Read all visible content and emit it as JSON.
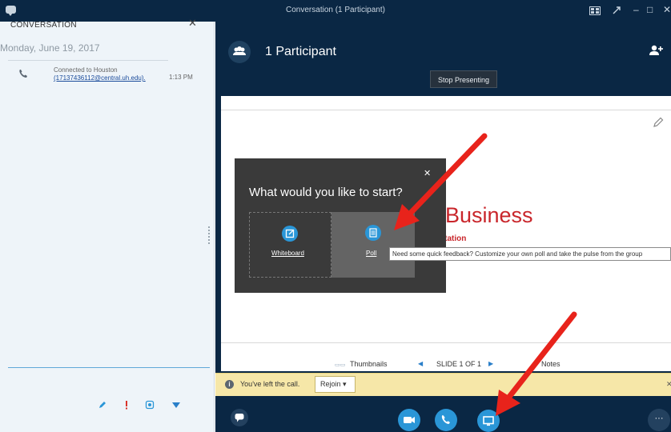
{
  "window": {
    "title": "Conversation (1 Participant)",
    "minimize_glyph": "–",
    "maximize_glyph": "□",
    "close_glyph": "✕"
  },
  "conversation_panel": {
    "heading": "CONVERSATION",
    "close_glyph": "✕",
    "date": "Monday, June 19, 2017",
    "event": {
      "line1": "Connected to Houston",
      "line2": "(17137436112@central.uh.edu).",
      "time": "1:13 PM",
      "icon": "phone-icon"
    },
    "toolbar_icons": [
      "pencil-icon",
      "priority-icon",
      "attach-icon",
      "emoticon-icon"
    ]
  },
  "stage": {
    "participants_label": "1 Participant",
    "stop_presenting": "Stop Presenting",
    "slide": {
      "title": "Business",
      "subtitle": "ntation"
    },
    "nav": {
      "thumbnails": "Thumbnails",
      "thumb_icon": "▭▭",
      "prev_glyph": "◀",
      "slide_counter": "SLIDE 1 OF 1",
      "next_glyph": "▶",
      "notes": "Notes"
    }
  },
  "popup": {
    "close_glyph": "✕",
    "question": "What would you like to start?",
    "options": [
      {
        "label": "Whiteboard",
        "icon": "whiteboard-icon"
      },
      {
        "label": "Poll",
        "icon": "poll-icon"
      }
    ],
    "tooltip": "Need some quick feedback? Customize your own poll and take the pulse from the group"
  },
  "notification": {
    "icon_glyph": "i",
    "text": "You've left the call.",
    "rejoin": "Rejoin ▾",
    "close_glyph": "✕"
  },
  "controls": {
    "chat": "chat-icon",
    "video": "video-icon",
    "call": "phone-icon",
    "present": "present-icon",
    "more_glyph": "···"
  },
  "colors": {
    "chrome": "#0a2744",
    "accent": "#2a96d7",
    "slide_title": "#c9262b",
    "notification": "#f6e7a8",
    "annotation_arrow": "#e8231b"
  }
}
